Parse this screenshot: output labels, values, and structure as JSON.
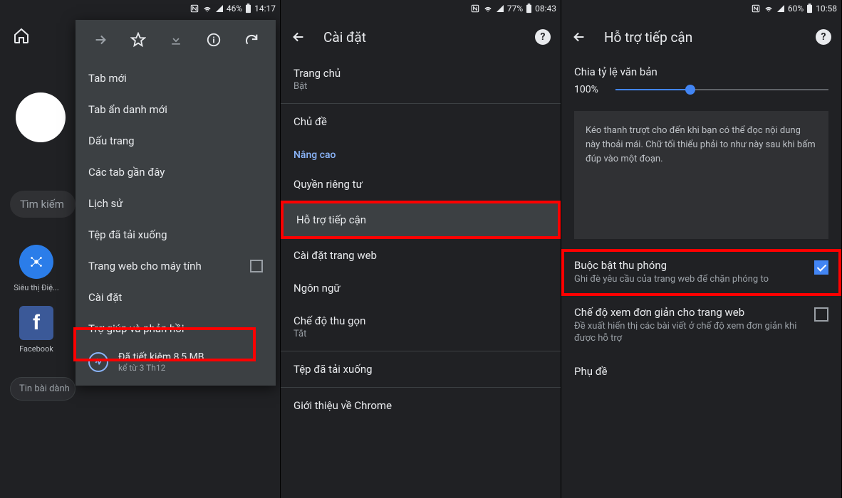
{
  "phone1": {
    "status": {
      "nfc": "N",
      "battery": "46%",
      "time": "14:17"
    },
    "search_placeholder": "Tìm kiếm",
    "apps": [
      {
        "label": "Siêu thị Điệ...",
        "color": "#3b5998",
        "icon_bg": "#2b7de9"
      },
      {
        "label": "Facebook",
        "color": "#3b5998",
        "icon_bg": "#3b5998"
      }
    ],
    "news_pill": "Tin bài dành",
    "menu": {
      "items": [
        "Tab mới",
        "Tab ẩn danh mới",
        "Dấu trang",
        "Các tab gần đây",
        "Lịch sử",
        "Tệp đã tải xuống",
        "Trang web cho máy tính",
        "Cài đặt",
        "Trợ giúp và phản hồi"
      ],
      "data_saver_title": "Đã tiết kiệm 8,5 MB",
      "data_saver_sub": "kể từ 3 Th12"
    }
  },
  "phone2": {
    "status": {
      "battery": "77%",
      "time": "08:43"
    },
    "title": "Cài đặt",
    "items": {
      "home_title": "Trang chủ",
      "home_sub": "Bật",
      "theme": "Chủ đề",
      "section": "Nâng cao",
      "privacy": "Quyền riêng tư",
      "accessibility": "Hỗ trợ tiếp cận",
      "site": "Cài đặt trang web",
      "lang": "Ngôn ngữ",
      "lite_title": "Chế độ thu gọn",
      "lite_sub": "Tắt",
      "downloads": "Tệp đã tải xuống",
      "about": "Giới thiệu về Chrome"
    }
  },
  "phone3": {
    "status": {
      "battery": "60%",
      "time": "10:58"
    },
    "title": "Hỗ trợ tiếp cận",
    "scaling_label": "Chia tỷ lệ văn bản",
    "scaling_value": "100%",
    "preview_text": "Kéo thanh trượt cho đến khi bạn có thể đọc nội dung này thoải mái. Chữ tối thiểu phải to như này sau khi bấm đúp vào một đoạn.",
    "zoom_title": "Buộc bật thu phóng",
    "zoom_desc": "Ghi đè yêu cầu của trang web để chặn phóng to",
    "simplified_title": "Chế độ xem đơn giản cho trang web",
    "simplified_desc": "Đề xuất hiển thị các bài viết ở chế độ xem đơn giản khi được hỗ trợ",
    "captions": "Phụ đề"
  }
}
